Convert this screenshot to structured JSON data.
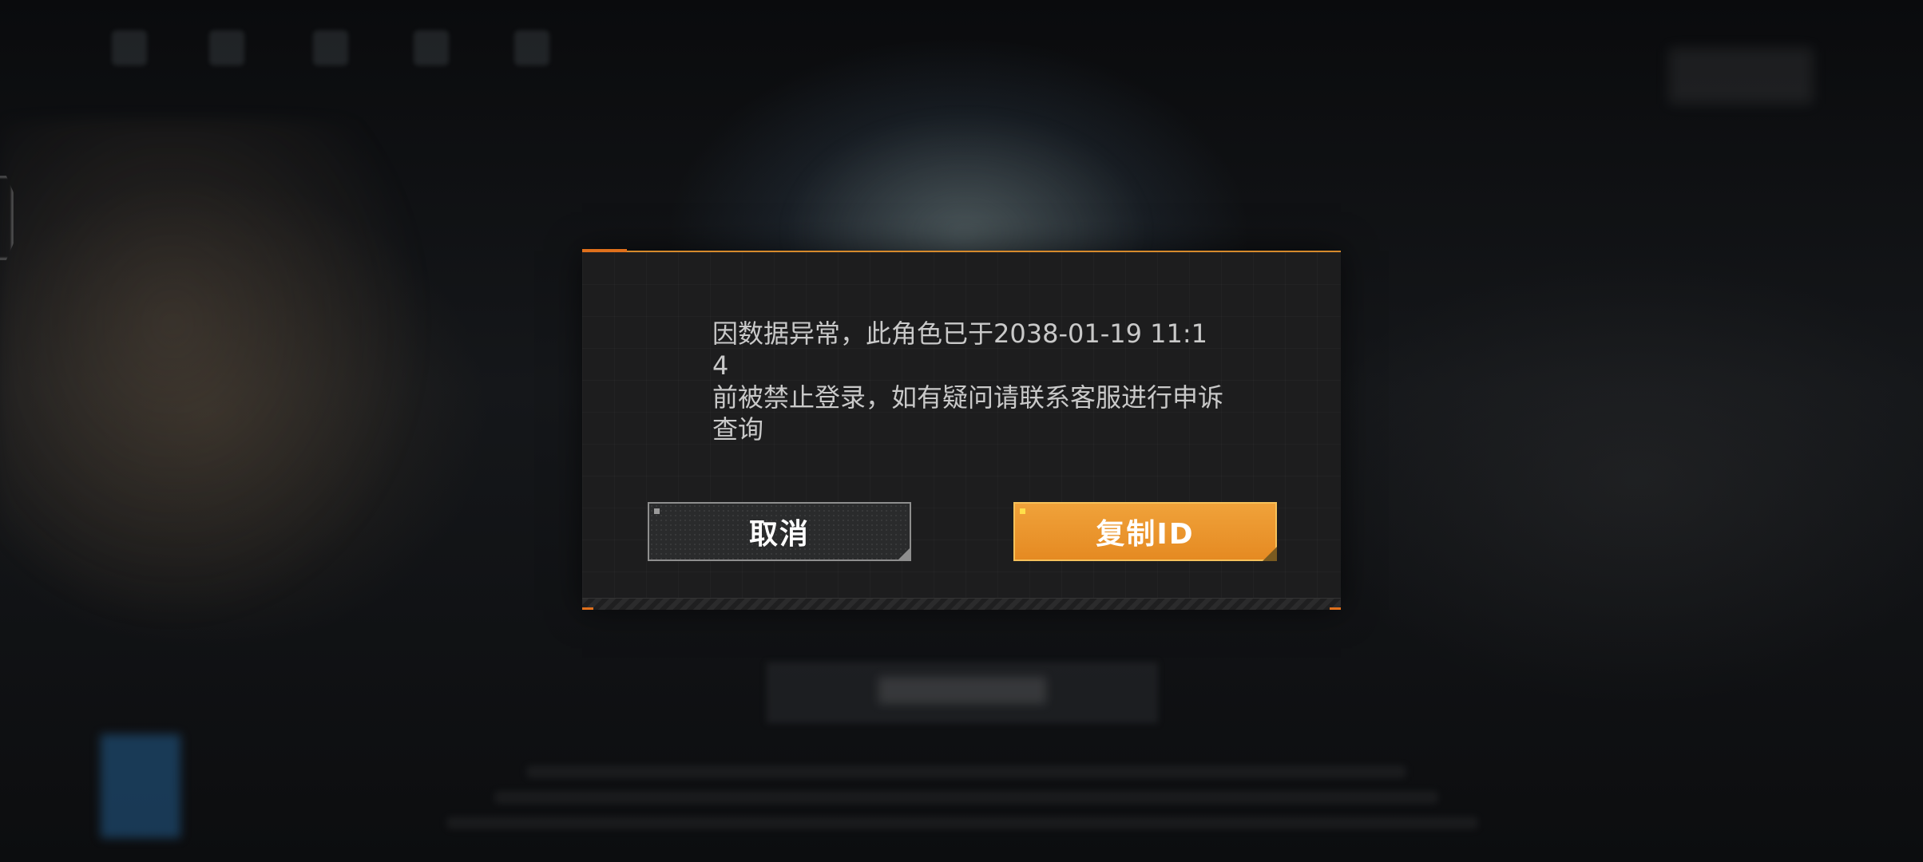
{
  "dialog": {
    "message": "因数据异常，此角色已于2038-01-19 11:14\n前被禁止登录，如有疑问请联系客服进行申诉\n查询",
    "cancel_label": "取消",
    "copy_id_label": "复制ID"
  },
  "colors": {
    "accent_orange": "#e0701c",
    "primary_button": "#e8901f",
    "dialog_background": "#1d1d1e"
  }
}
